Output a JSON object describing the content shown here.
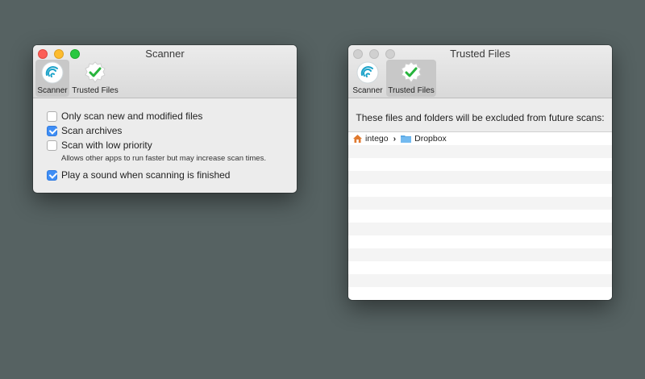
{
  "scanner_window": {
    "title": "Scanner",
    "toolbar": [
      {
        "label": "Scanner",
        "icon": "scanner-icon",
        "selected": true
      },
      {
        "label": "Trusted Files",
        "icon": "trusted-files-icon",
        "selected": false
      }
    ],
    "options": [
      {
        "label": "Only scan new and modified files",
        "checked": false
      },
      {
        "label": "Scan archives",
        "checked": true
      },
      {
        "label": "Scan with low priority",
        "checked": false,
        "sublabel": "Allows other apps to run faster but may increase scan times."
      },
      {
        "label": "Play a sound when scanning is finished",
        "checked": true
      }
    ]
  },
  "trusted_window": {
    "title": "Trusted Files",
    "toolbar": [
      {
        "label": "Scanner",
        "icon": "scanner-icon",
        "selected": false
      },
      {
        "label": "Trusted Files",
        "icon": "trusted-files-icon",
        "selected": true
      }
    ],
    "message": "These files and folders will be excluded from future scans:",
    "items": [
      {
        "path": [
          "intego",
          "Dropbox"
        ],
        "icons": [
          "home-icon",
          "folder-icon"
        ]
      }
    ],
    "add_button": "+",
    "remove_button": "—"
  },
  "colors": {
    "desktop": "#566262",
    "accent": "#3f8ef5",
    "check_green": "#27b43c",
    "scanner_teal": "#1aa2c9"
  }
}
